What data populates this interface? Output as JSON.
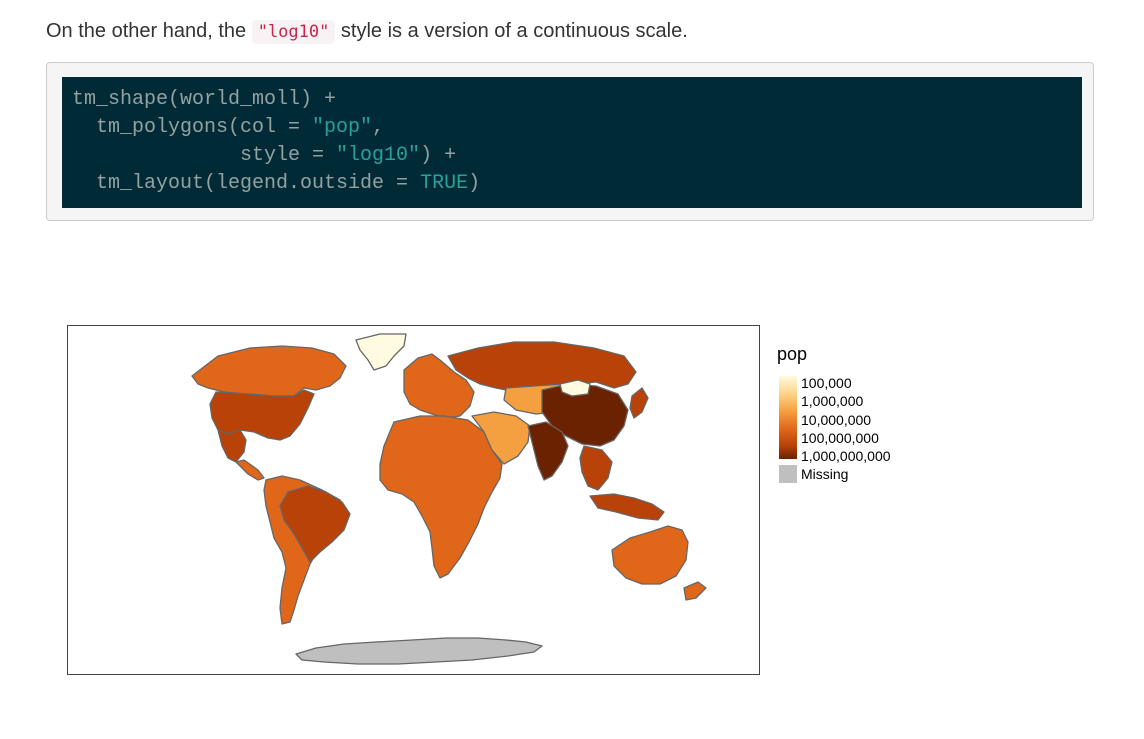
{
  "paragraph": {
    "prefix": "On the other hand, the ",
    "code": "\"log10\"",
    "suffix": " style is a version of a continuous scale."
  },
  "code_lines": {
    "l1": "tm_shape(world_moll) +",
    "l2_a": "  tm_polygons(col = ",
    "l2_b": "\"pop\"",
    "l2_c": ",",
    "l3_a": "              style = ",
    "l3_b": "\"log10\"",
    "l3_c": ") +",
    "l4_a": "  tm_layout(legend.outside = ",
    "l4_b": "TRUE",
    "l4_c": ")"
  },
  "legend": {
    "title": "pop",
    "labels": [
      "100,000",
      "1,000,000",
      "10,000,000",
      "100,000,000",
      "1,000,000,000"
    ],
    "missing_label": "Missing",
    "palette": [
      "#fffbe0",
      "#fdd68e",
      "#f5a040",
      "#e0661a",
      "#b84207",
      "#6b2200"
    ],
    "missing_color": "#bfbfbf"
  },
  "map": {
    "region_fills": {
      "north-america": "#b84207",
      "canada": "#e0661a",
      "greenland": "#fffbe0",
      "south-america": "#e0661a",
      "brazil": "#b84207",
      "europe": "#e0661a",
      "russia": "#b84207",
      "africa": "#e0661a",
      "middle-east": "#f5a040",
      "china": "#6b2200",
      "india": "#6b2200",
      "southeast-asia": "#b84207",
      "australia": "#e0661a",
      "antarctica": "#bfbfbf"
    }
  }
}
